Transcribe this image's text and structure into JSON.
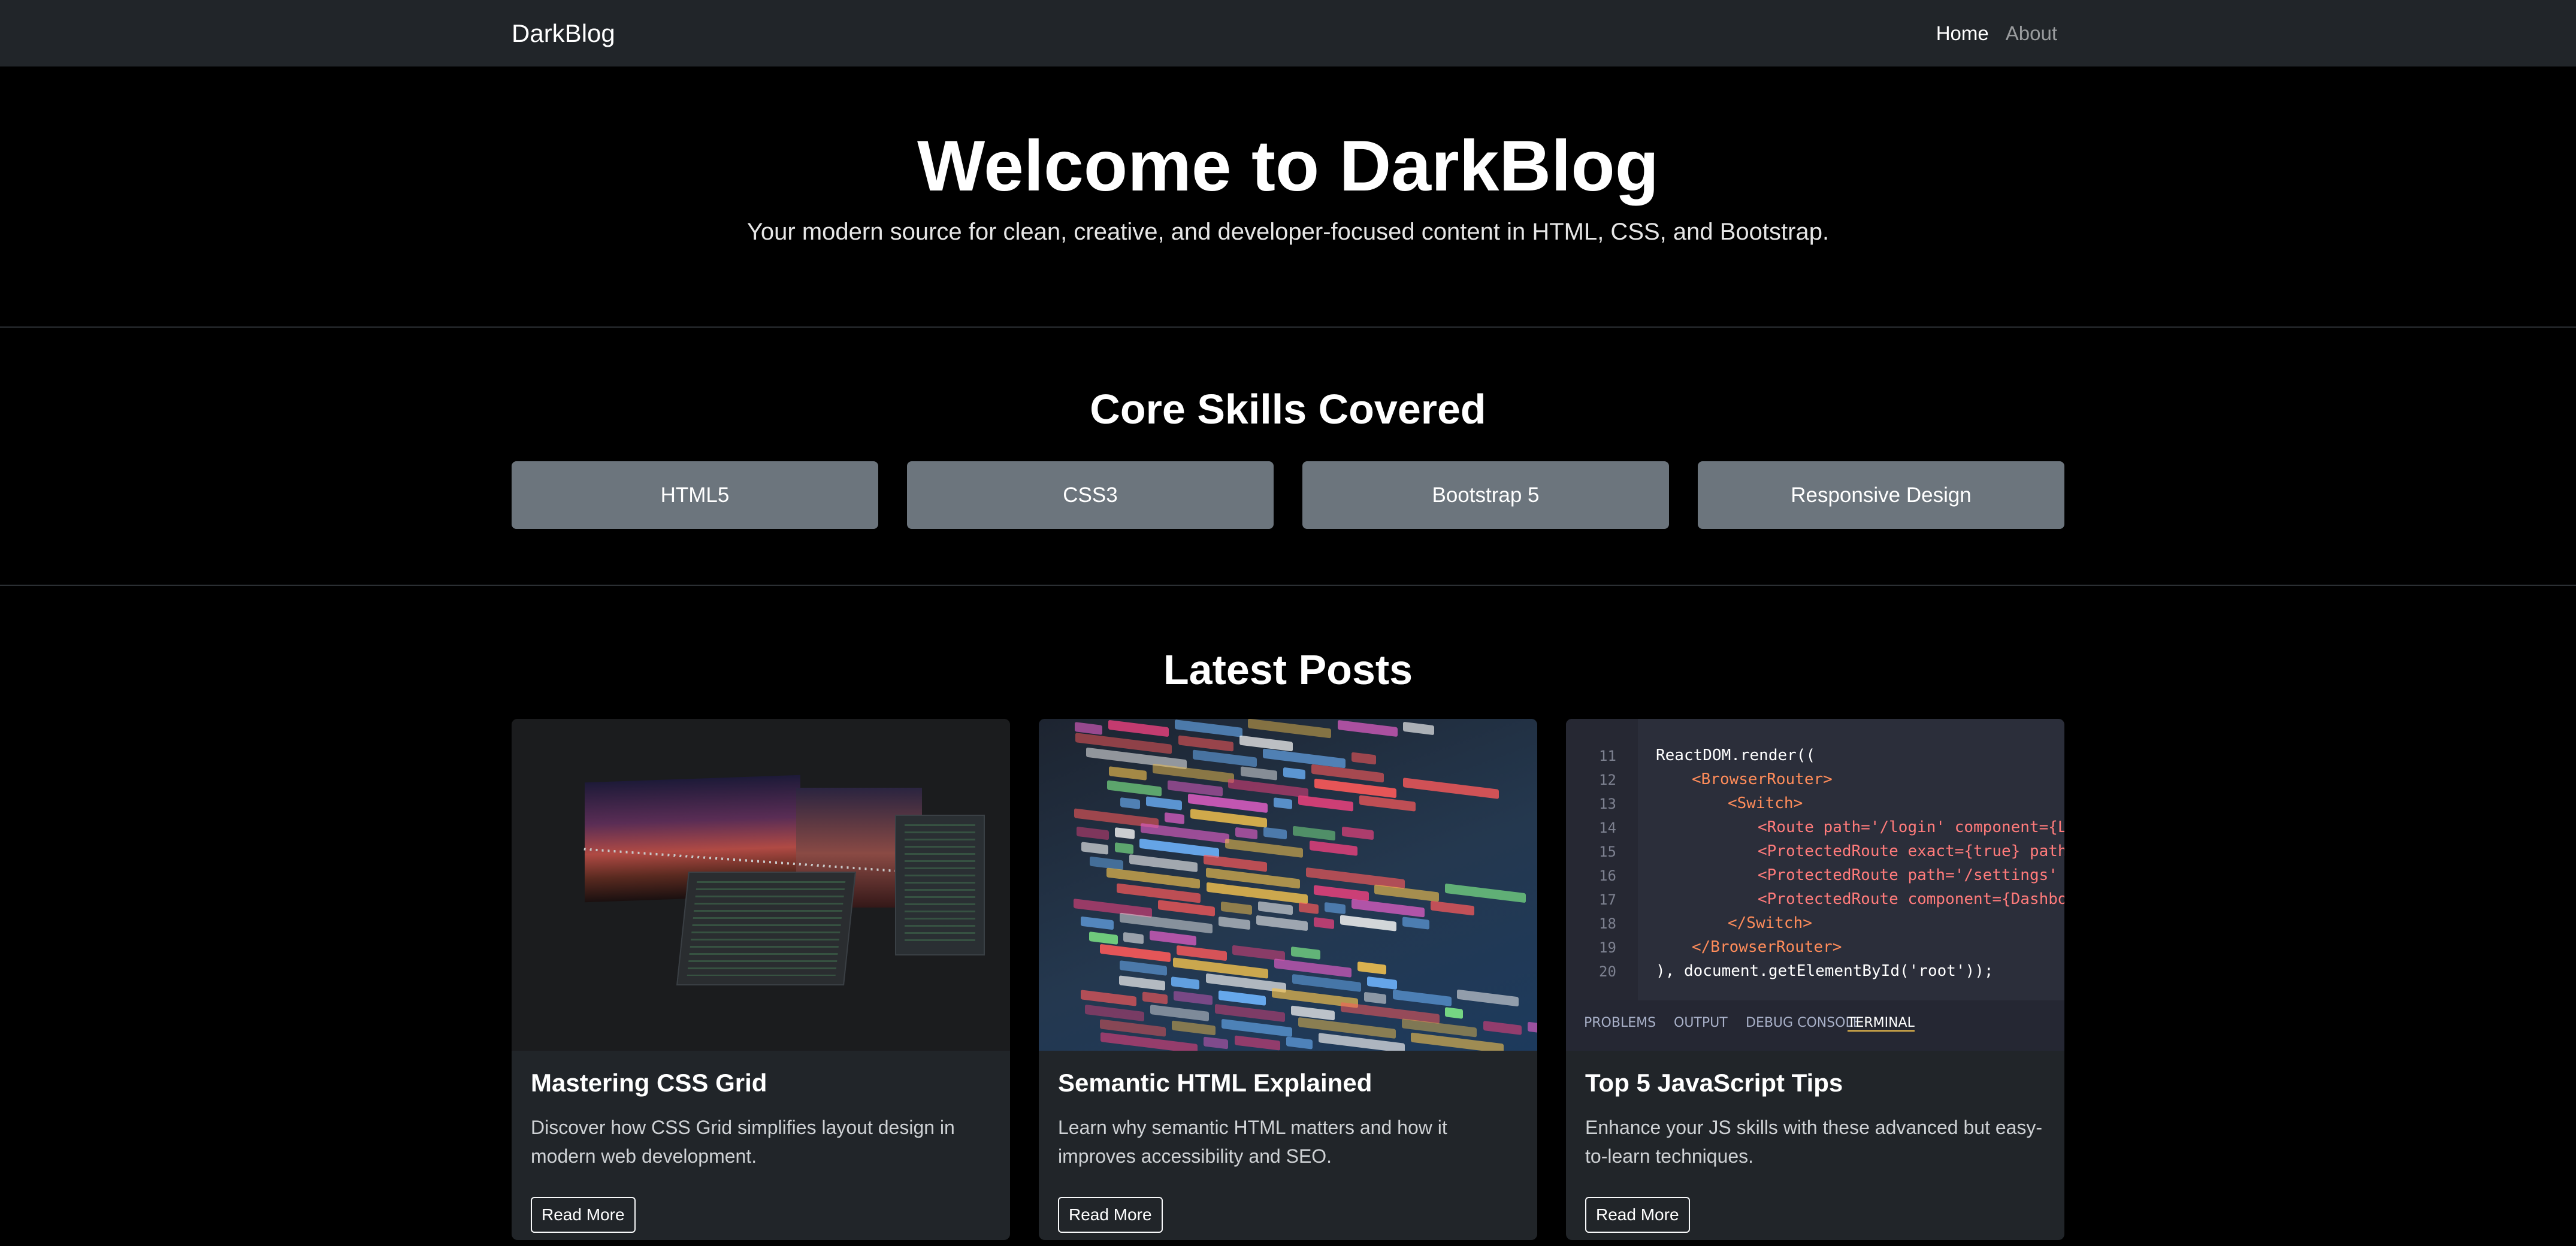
{
  "navbar": {
    "brand": "DarkBlog",
    "links": [
      {
        "label": "Home",
        "active": true
      },
      {
        "label": "About",
        "active": false
      }
    ]
  },
  "hero": {
    "title": "Welcome to DarkBlog",
    "subtitle": "Your modern source for clean, creative, and developer-focused content in HTML, CSS, and Bootstrap."
  },
  "skills": {
    "title": "Core Skills Covered",
    "items": [
      "HTML5",
      "CSS3",
      "Bootstrap 5",
      "Responsive Design"
    ]
  },
  "posts": {
    "title": "Latest Posts",
    "items": [
      {
        "title": "Mastering CSS Grid",
        "text": "Discover how CSS Grid simplifies layout design in modern web development.",
        "button": "Read More",
        "image": "dark-desk-monitors-image"
      },
      {
        "title": "Semantic HTML Explained",
        "text": "Learn why semantic HTML matters and how it improves accessibility and SEO.",
        "button": "Read More",
        "image": "colorful-code-closeup-image"
      },
      {
        "title": "Top 5 JavaScript Tips",
        "text": "Enhance your JS skills with these advanced but easy-to-learn techniques.",
        "button": "Read More",
        "image": "code-editor-react-router-image",
        "editor": {
          "lines": [
            "11",
            "12",
            "13",
            "14",
            "15",
            "16",
            "17",
            "18",
            "19",
            "20"
          ],
          "code": [
            "ReactDOM.render((",
            "<BrowserRouter>",
            "<Switch>",
            "<Route path='/login' component={Login} />",
            "<ProtectedRoute exact={true} path='/' component=",
            "<ProtectedRoute path='/settings' component={Se",
            "<ProtectedRoute component={Dashboard} />",
            "</Switch>",
            "</BrowserRouter>",
            "), document.getElementById('root'));"
          ],
          "panel_tabs": [
            "PROBLEMS",
            "OUTPUT",
            "DEBUG CONSOLE",
            "TERMINAL"
          ]
        }
      }
    ]
  },
  "colors": {
    "page_bg": "#000000",
    "navbar_bg": "#212529",
    "card_bg": "#212529",
    "skill_bg": "#6c757d"
  }
}
